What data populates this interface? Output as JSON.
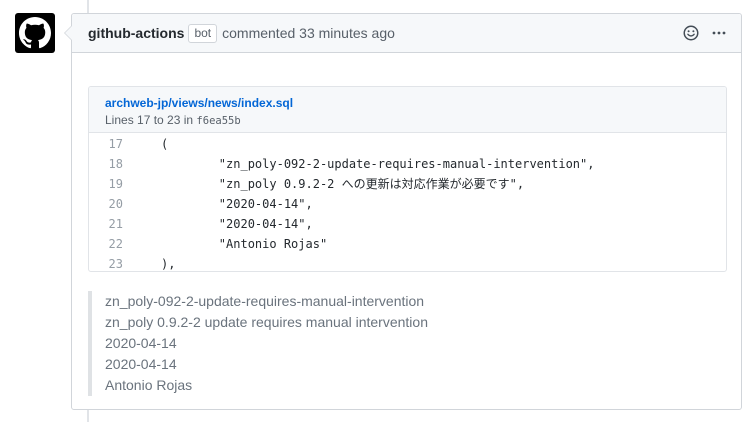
{
  "comment": {
    "author": "github-actions",
    "badge": "bot",
    "meta": "commented 33 minutes ago",
    "actions": [
      {
        "icon": "smiley-icon"
      },
      {
        "icon": "kebab-horizontal-icon"
      }
    ]
  },
  "snippet": {
    "file_path": "archweb-jp/views/news/index.sql",
    "lines_prefix": "Lines 17 to 23 in",
    "commit": "f6ea55b",
    "lines": [
      {
        "num": "17",
        "code": "("
      },
      {
        "num": "18",
        "code": "        \"zn_poly-092-2-update-requires-manual-intervention\","
      },
      {
        "num": "19",
        "code": "        \"zn_poly 0.9.2-2 への更新は対応作業が必要です\","
      },
      {
        "num": "20",
        "code": "        \"2020-04-14\","
      },
      {
        "num": "21",
        "code": "        \"2020-04-14\","
      },
      {
        "num": "22",
        "code": "        \"Antonio Rojas\""
      },
      {
        "num": "23",
        "code": "),"
      }
    ]
  },
  "quote": {
    "lines": [
      "zn_poly-092-2-update-requires-manual-intervention",
      "zn_poly 0.9.2-2 update requires manual intervention",
      "2020-04-14",
      "2020-04-14",
      "Antonio Rojas"
    ]
  },
  "colors": {
    "link": "#0366d6",
    "header_bg": "#f6f8fa",
    "border": "#d1d5da"
  }
}
